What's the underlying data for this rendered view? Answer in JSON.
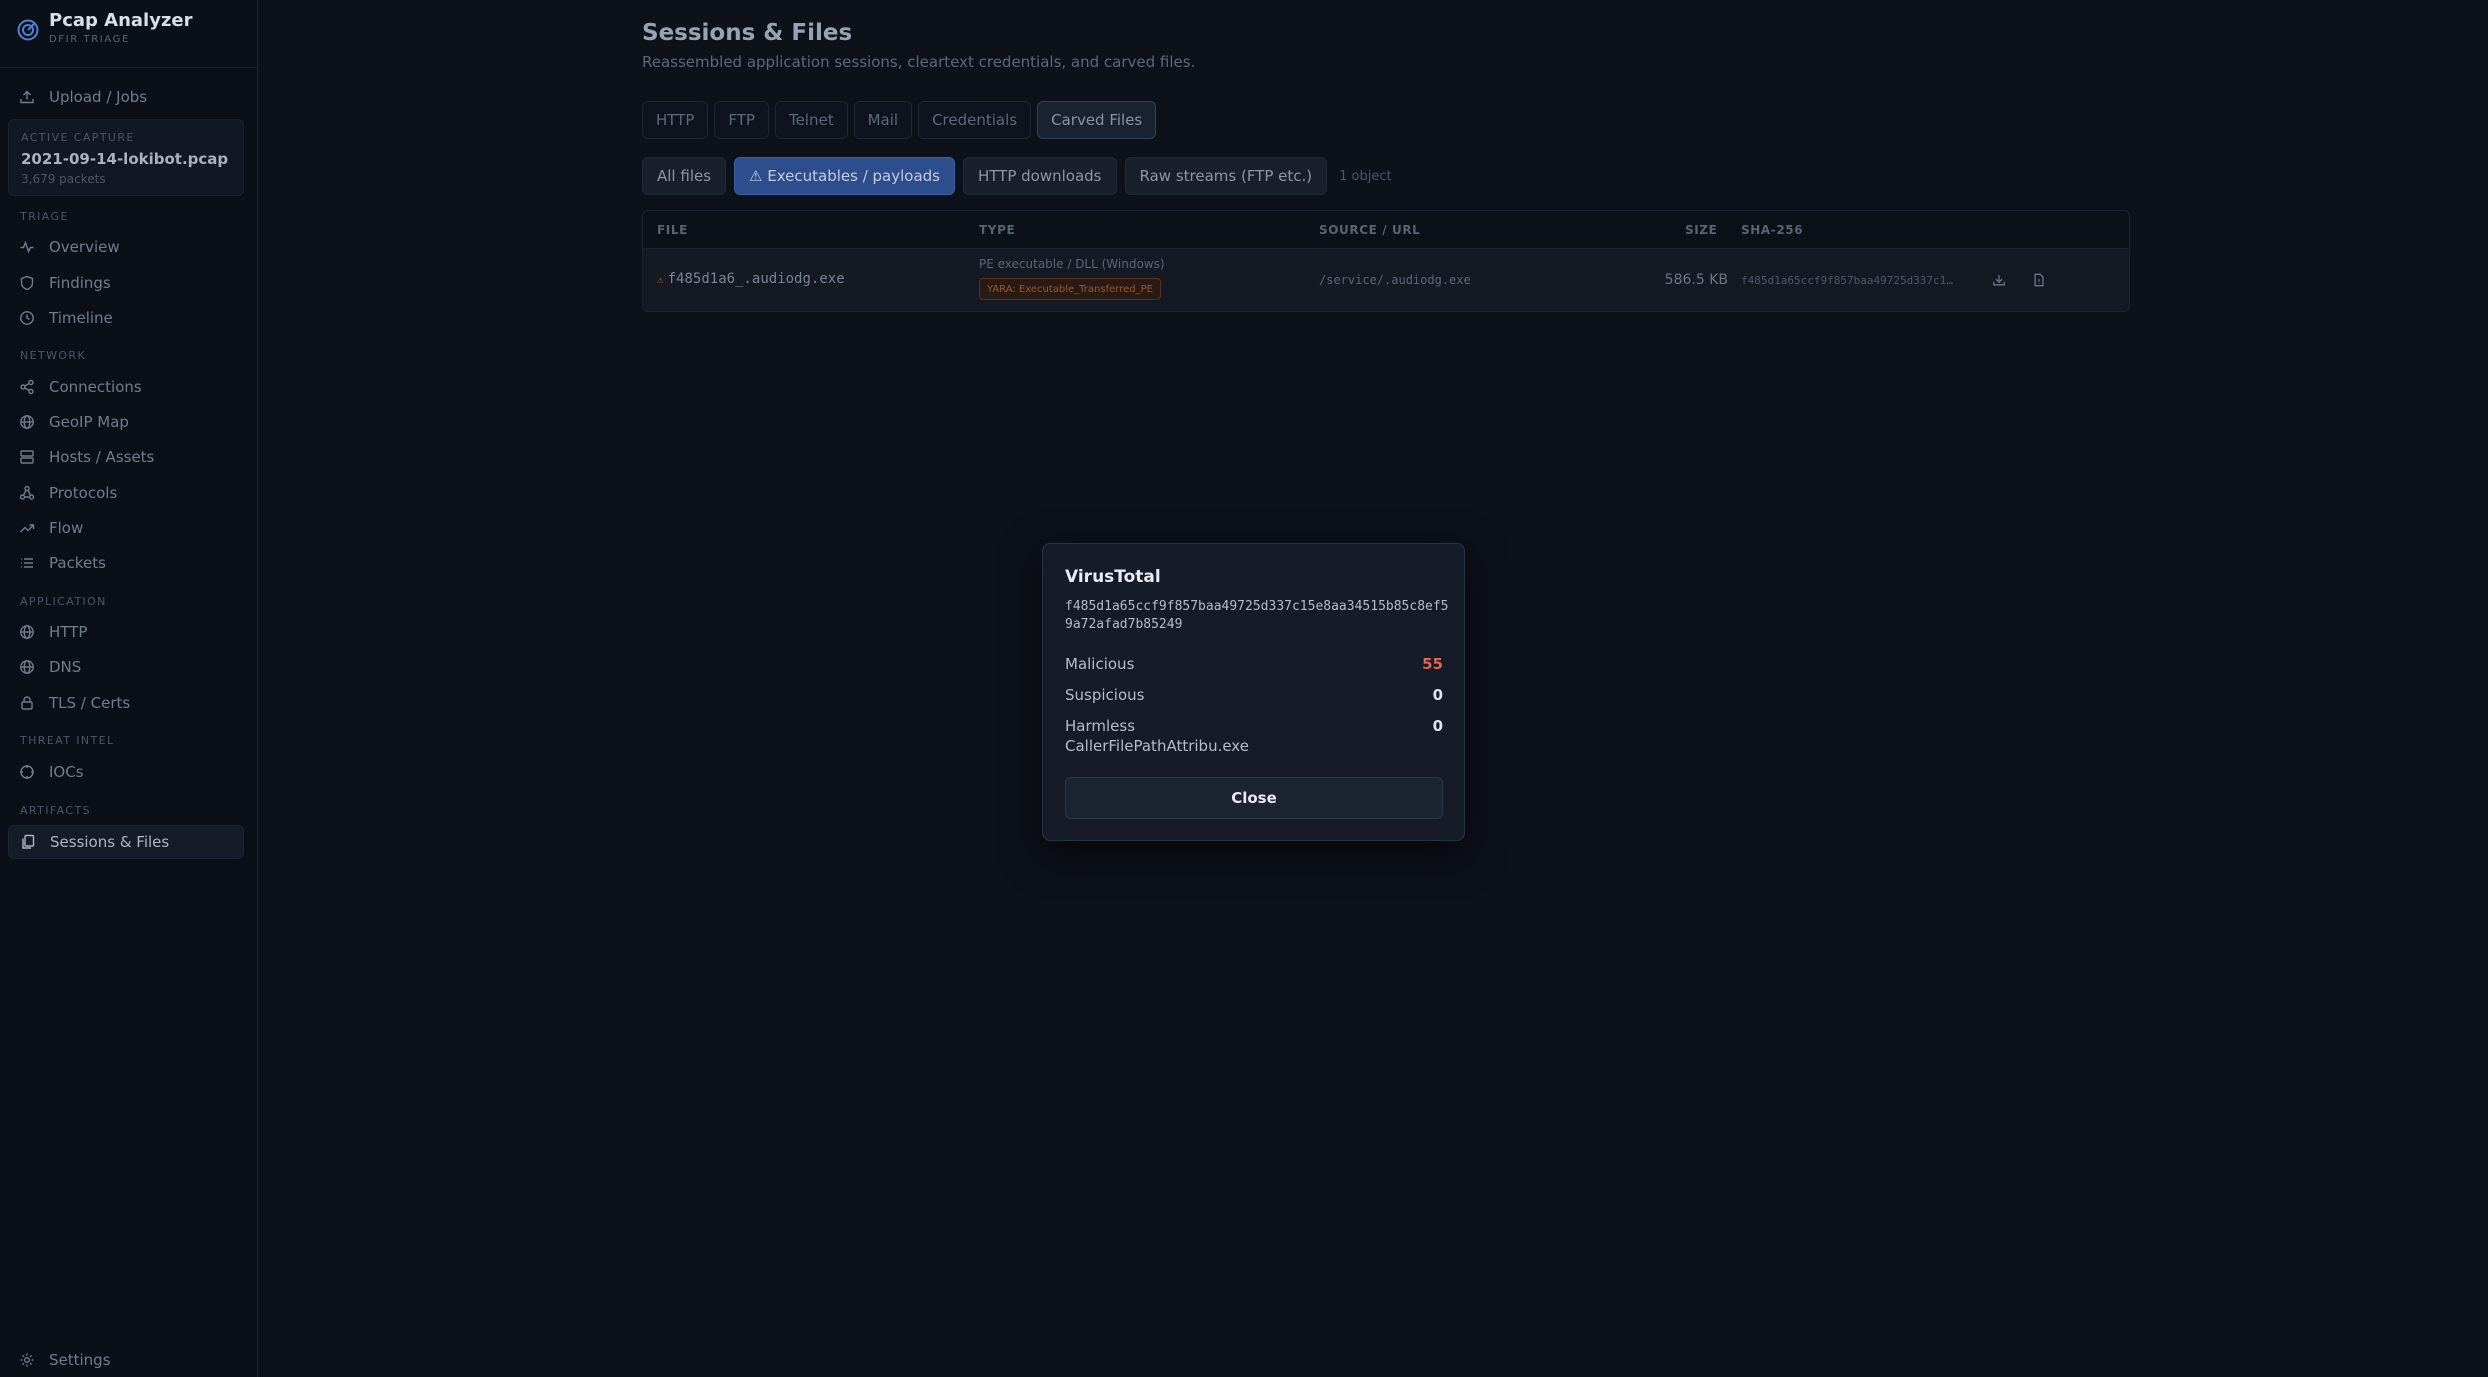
{
  "brand": {
    "title": "Pcap Analyzer",
    "subtitle": "DFIR TRIAGE"
  },
  "nav": {
    "upload": "Upload / Jobs",
    "capture": {
      "label": "ACTIVE CAPTURE",
      "name": "2021-09-14-lokibot.pcap",
      "count": "3,679 packets"
    },
    "sections": {
      "triage": "TRIAGE",
      "network": "NETWORK",
      "application": "APPLICATION",
      "threat": "THREAT INTEL",
      "artifacts": "ARTIFACTS"
    },
    "items": {
      "overview": "Overview",
      "findings": "Findings",
      "timeline": "Timeline",
      "connections": "Connections",
      "geoip": "GeoIP Map",
      "hosts": "Hosts / Assets",
      "protocols": "Protocols",
      "flow": "Flow",
      "packets": "Packets",
      "http": "HTTP",
      "dns": "DNS",
      "tls": "TLS / Certs",
      "iocs": "IOCs",
      "sessions": "Sessions & Files"
    },
    "settings": "Settings"
  },
  "page": {
    "title": "Sessions & Files",
    "subtitle": "Reassembled application sessions, cleartext credentials, and carved files."
  },
  "tabs": [
    "HTTP",
    "FTP",
    "Telnet",
    "Mail",
    "Credentials",
    "Carved Files"
  ],
  "filters": {
    "all": "All files",
    "exec": "⚠ Executables / payloads",
    "http": "HTTP downloads",
    "raw": "Raw streams (FTP etc.)",
    "count": "1 object"
  },
  "table": {
    "headers": {
      "file": "FILE",
      "type": "TYPE",
      "source": "SOURCE / URL",
      "size": "SIZE",
      "sha": "SHA-256"
    },
    "row": {
      "warn": "⚠",
      "file": "f485d1a6_.audiodg.exe",
      "type": "PE executable / DLL (Windows)",
      "yara": "YARA: Executable_Transferred_PE",
      "source": "/service/.audiodg.exe",
      "size": "586.5 KB",
      "sha": "f485d1a65ccf9f857baa49725d337c15e8aa34515b85c8ef59a72afad7b85249"
    }
  },
  "modal": {
    "title": "VirusTotal",
    "hash": "f485d1a65ccf9f857baa49725d337c15e8aa34515b85c8ef59a72afad7b85249",
    "malicious_label": "Malicious",
    "malicious_value": "55",
    "suspicious_label": "Suspicious",
    "suspicious_value": "0",
    "harmless_label": "Harmless",
    "harmless_value": "0",
    "name": "CallerFilePathAttribu.exe",
    "close": "Close"
  }
}
